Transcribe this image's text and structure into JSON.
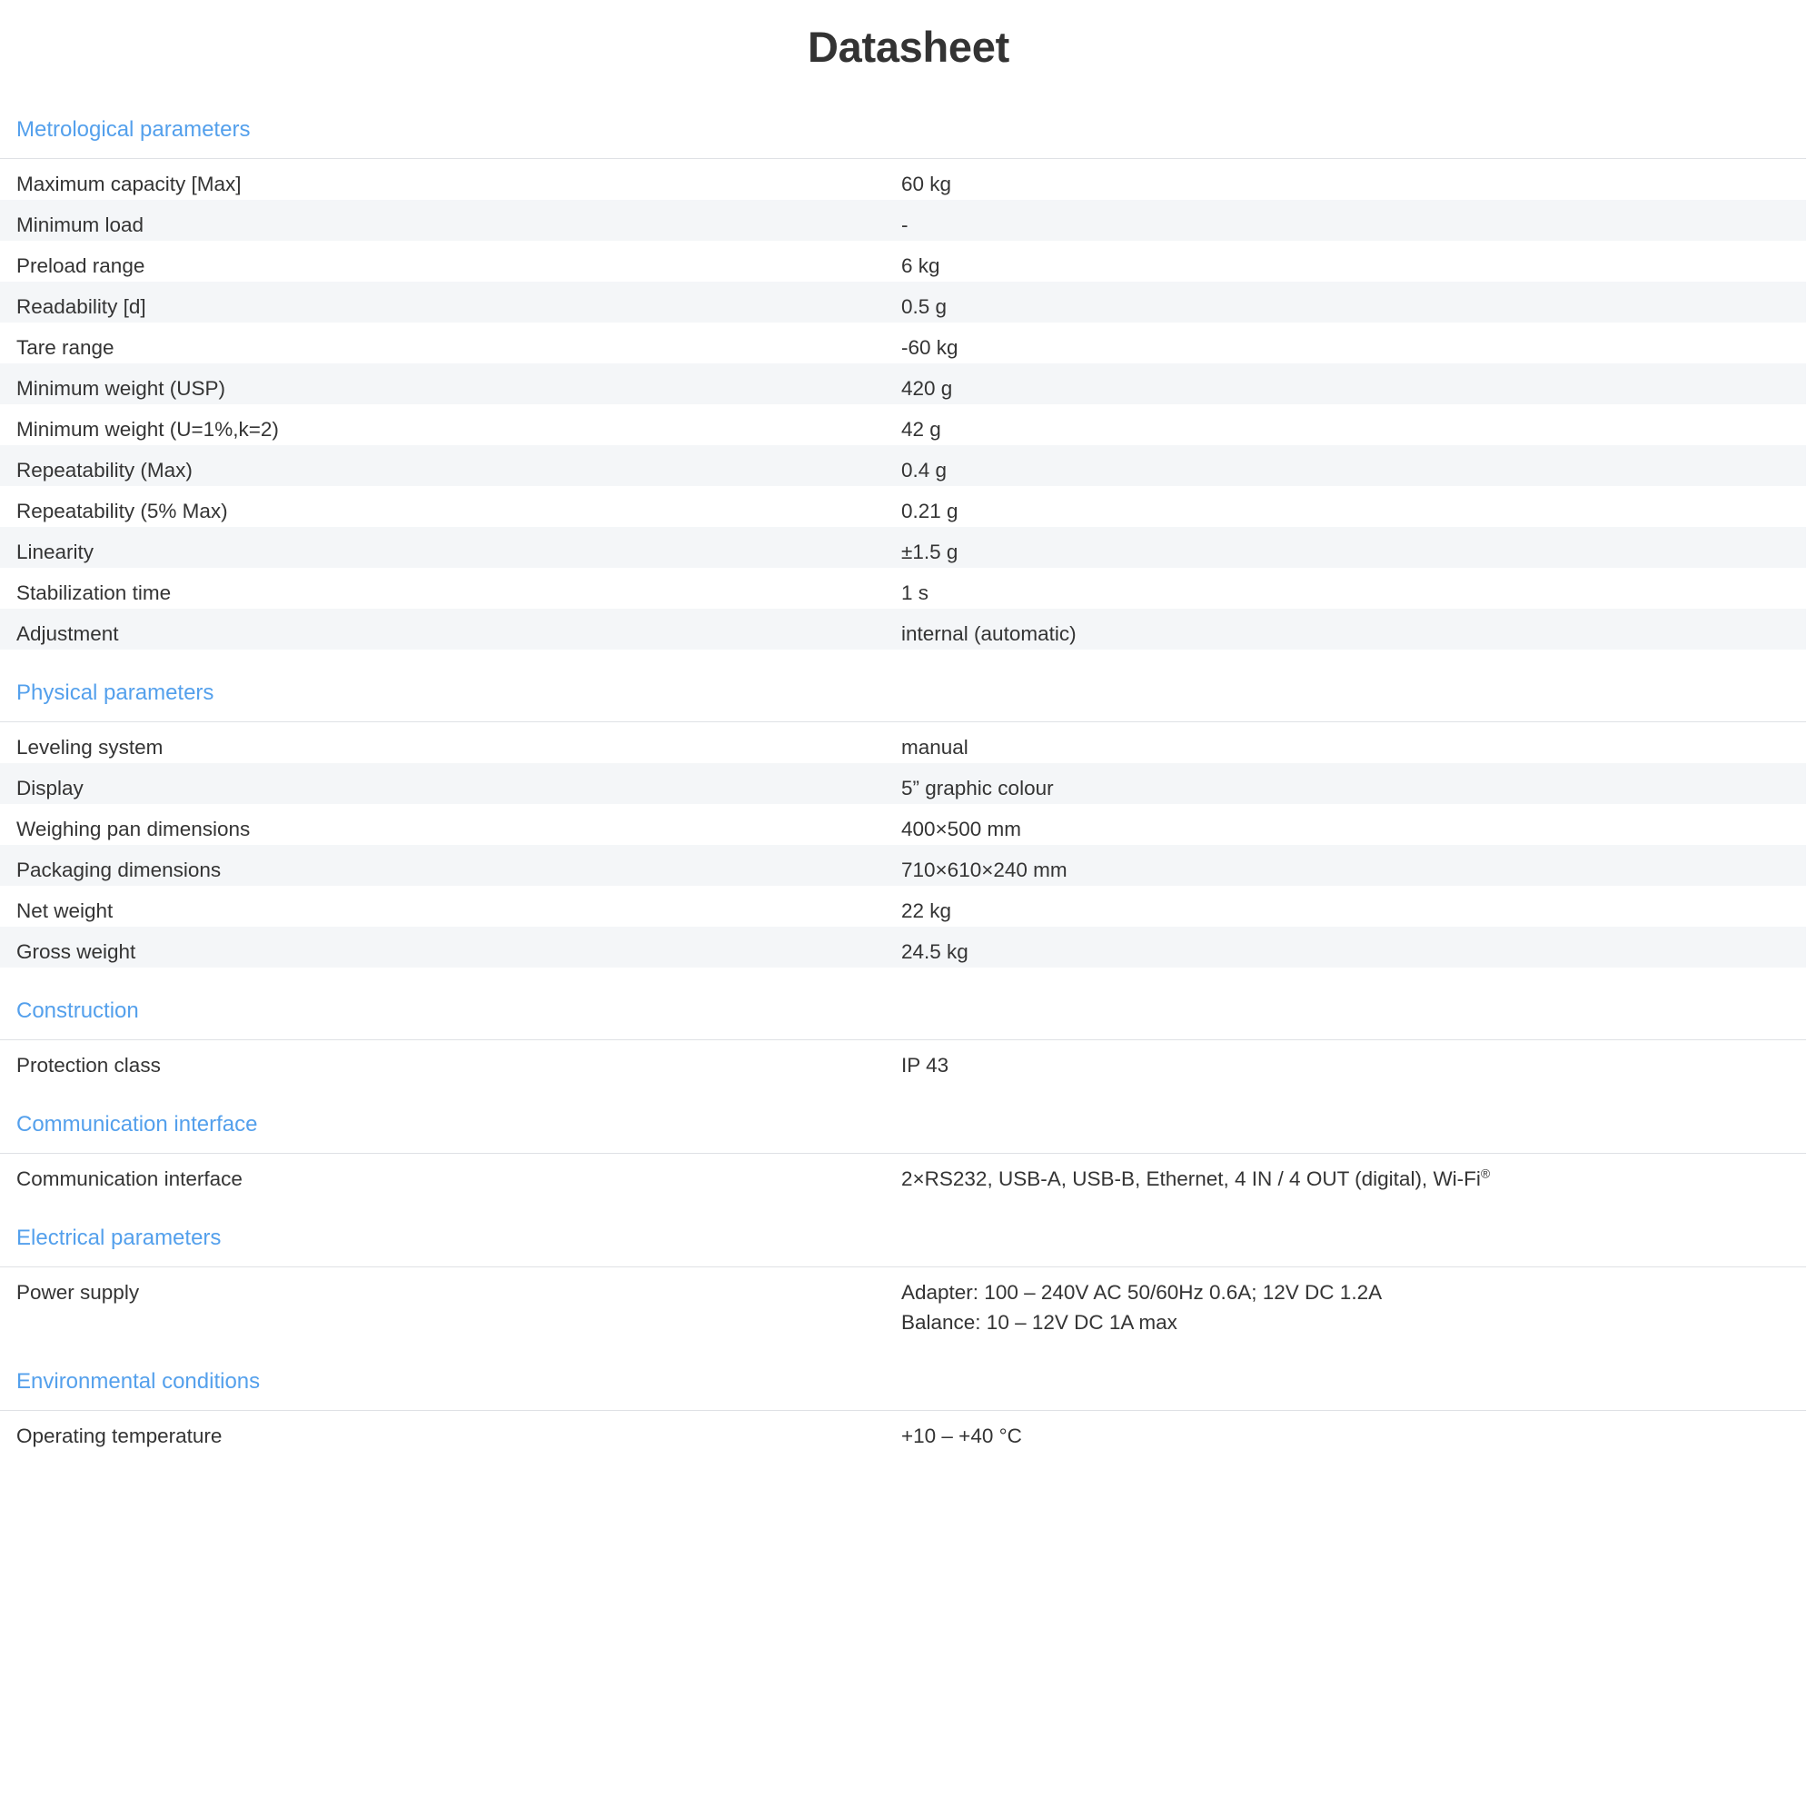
{
  "title": "Datasheet",
  "colors": {
    "section_header": "#54a0ec",
    "text": "#343434",
    "row_shaded": "#f4f6f8",
    "rule": "#dfe1e5"
  },
  "sections": [
    {
      "header": "Metrological parameters",
      "rows": [
        {
          "label": "Maximum capacity [Max]",
          "value": "60 kg"
        },
        {
          "label": "Minimum load",
          "value": "-"
        },
        {
          "label": "Preload range",
          "value": "6 kg"
        },
        {
          "label": "Readability [d]",
          "value": "0.5 g"
        },
        {
          "label": "Tare range",
          "value": "-60 kg"
        },
        {
          "label": "Minimum weight (USP)",
          "value": "420 g"
        },
        {
          "label": "Minimum weight (U=1%,k=2)",
          "value": "42 g"
        },
        {
          "label": "Repeatability (Max)",
          "value": "0.4 g"
        },
        {
          "label": "Repeatability (5% Max)",
          "value": "0.21 g"
        },
        {
          "label": "Linearity",
          "value": "±1.5 g"
        },
        {
          "label": "Stabilization time",
          "value": "1 s"
        },
        {
          "label": "Adjustment",
          "value": "internal (automatic)"
        }
      ]
    },
    {
      "header": "Physical parameters",
      "rows": [
        {
          "label": "Leveling system",
          "value": "manual"
        },
        {
          "label": "Display",
          "value": "5” graphic colour"
        },
        {
          "label": "Weighing pan dimensions",
          "value": "400×500 mm"
        },
        {
          "label": "Packaging dimensions",
          "value": "710×610×240 mm"
        },
        {
          "label": "Net weight",
          "value": "22 kg"
        },
        {
          "label": "Gross weight",
          "value": "24.5 kg"
        }
      ]
    },
    {
      "header": "Construction",
      "rows": [
        {
          "label": "Protection class",
          "value": "IP 43"
        }
      ]
    },
    {
      "header": "Communication interface",
      "rows": [
        {
          "label": "Communication interface",
          "value_html": "2×RS232, USB-A, USB-B, Ethernet, 4 IN / 4 OUT (digital), Wi-Fi<sup>®</sup>",
          "value": "2×RS232, USB-A, USB-B, Ethernet, 4 IN / 4 OUT (digital), Wi-Fi®"
        }
      ]
    },
    {
      "header": "Electrical parameters",
      "rows": [
        {
          "label": "Power supply",
          "value": "Adapter: 100 – 240V AC 50/60Hz 0.6A; 12V DC 1.2A\nBalance: 10 – 12V DC 1A max",
          "tall": true
        }
      ]
    },
    {
      "header": "Environmental conditions",
      "rows": [
        {
          "label": "Operating temperature",
          "value": "+10 – +40 °C"
        }
      ]
    }
  ]
}
